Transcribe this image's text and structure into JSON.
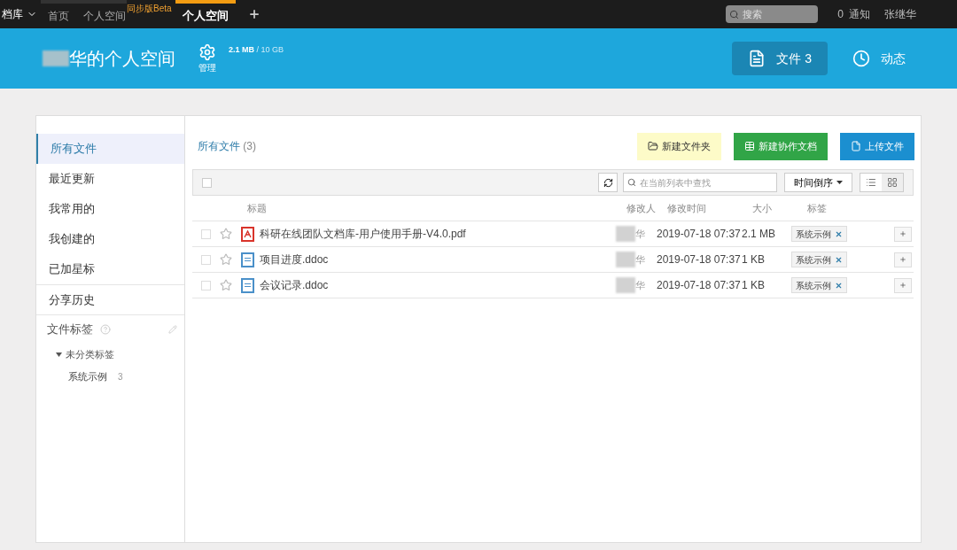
{
  "topbar": {
    "app": "档库",
    "nav": [
      {
        "label": "首页",
        "selected": false
      },
      {
        "label": "个人空间",
        "badge": "同步版Beta",
        "selected": false
      },
      {
        "label": "个人空间",
        "selected": true
      }
    ],
    "search": {
      "placeholder": "搜索"
    },
    "notifications": {
      "count": "0",
      "label": "通知"
    },
    "user": "张继华"
  },
  "banner": {
    "title": "华的个人空间",
    "manage": "管理",
    "usage": "2.1 MB",
    "quota": "/ 10 GB",
    "tabs": [
      {
        "label": "文件 3",
        "selected": true
      },
      {
        "label": "动态",
        "selected": false
      }
    ]
  },
  "sidebar": {
    "items": [
      {
        "label": "所有文件",
        "selected": true
      },
      {
        "label": "最近更新",
        "selected": false
      },
      {
        "label": "我常用的",
        "selected": false
      },
      {
        "label": "我创建的",
        "selected": false
      },
      {
        "label": "已加星标",
        "selected": false
      },
      {
        "label": "分享历史",
        "selected": false
      }
    ],
    "tags_title": "文件标签",
    "tag_groups": [
      {
        "label": "未分类标签",
        "expanded": true,
        "children": [
          {
            "label": "系统示例",
            "count": "3"
          }
        ]
      }
    ]
  },
  "main": {
    "title": "所有文件",
    "count": "(3)",
    "buttons": [
      {
        "label": "新建文件夹",
        "kind": "folder"
      },
      {
        "label": "新建协作文档",
        "kind": "doc"
      },
      {
        "label": "上传文件",
        "kind": "upload"
      }
    ],
    "all_checked": false,
    "filter": {
      "placeholder": "在当前列表中查找"
    },
    "sort": "时间倒序",
    "table": {
      "columns": [
        "标题",
        "修改人",
        "修改时间",
        "大小",
        "标签"
      ],
      "rows": [
        {
          "name": "科研在线团队文档库-用户使用手册-V4.0.pdf",
          "kind": "pdf",
          "starred": false,
          "checked": false,
          "modifier": "华",
          "time": "2019-07-18 07:37",
          "size": "2.1 MB",
          "tag": "系统示例"
        },
        {
          "name": "项目进度.ddoc",
          "kind": "ddoc",
          "starred": false,
          "checked": false,
          "modifier": "华",
          "time": "2019-07-18 07:37",
          "size": "1 KB",
          "tag": "系统示例"
        },
        {
          "name": "会议记录.ddoc",
          "kind": "ddoc",
          "starred": false,
          "checked": false,
          "modifier": "华",
          "time": "2019-07-18 07:37",
          "size": "1 KB",
          "tag": "系统示例"
        }
      ]
    }
  }
}
